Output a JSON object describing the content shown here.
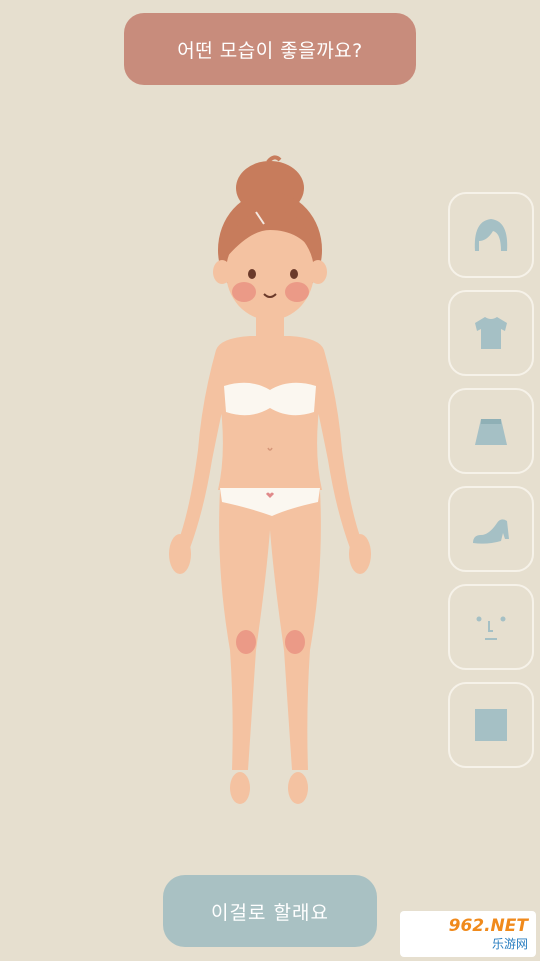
{
  "header": {
    "question": "어떤 모습이 좋을까요?"
  },
  "categories": [
    {
      "name": "hair",
      "icon": "hair-icon"
    },
    {
      "name": "top",
      "icon": "shirt-icon"
    },
    {
      "name": "bottom",
      "icon": "skirt-icon"
    },
    {
      "name": "shoes",
      "icon": "shoe-icon"
    },
    {
      "name": "face",
      "icon": "face-icon"
    },
    {
      "name": "background",
      "icon": "square-icon"
    }
  ],
  "footer": {
    "confirm_label": "이걸로 할래요"
  },
  "watermark": {
    "line1": "962.NET",
    "line2": "乐游网"
  },
  "colors": {
    "background": "#e6dfcf",
    "question_bg": "#c88c7c",
    "confirm_bg": "#a9c1c3",
    "icon": "#a5c0c5",
    "skin": "#f4c2a1",
    "hair": "#c77c5c"
  }
}
